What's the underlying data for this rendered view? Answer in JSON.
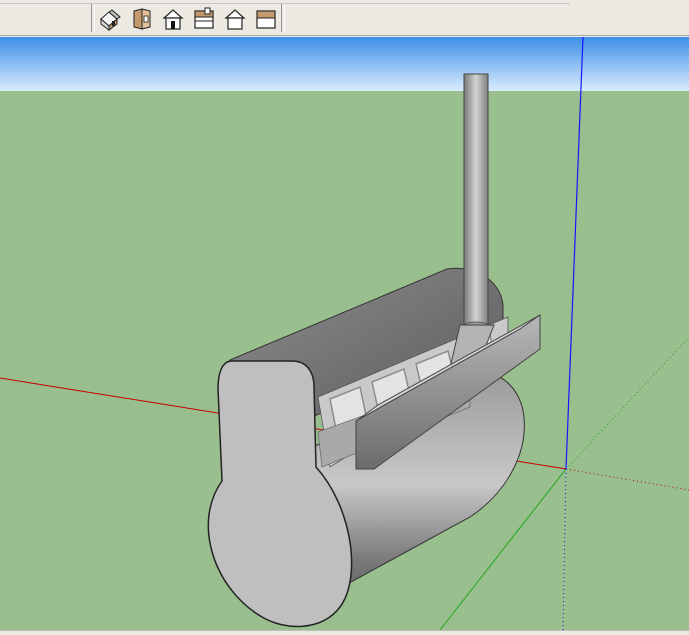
{
  "toolbar": {
    "tools": [
      {
        "name": "iso-view",
        "icon": "iso-house-icon"
      },
      {
        "name": "top-view",
        "icon": "top-view-icon"
      },
      {
        "name": "front-view",
        "icon": "front-view-icon"
      },
      {
        "name": "right-view",
        "icon": "right-view-icon"
      },
      {
        "name": "back-view",
        "icon": "back-view-icon"
      },
      {
        "name": "left-view",
        "icon": "left-view-icon"
      }
    ]
  },
  "scene": {
    "sky_top_color": "#3e8ee8",
    "sky_bottom_color": "#dff0ff",
    "ground_color": "#9abf8e",
    "axis_colors": {
      "red": "#c20000",
      "green": "#1ea81e",
      "blue": "#1515ff"
    }
  }
}
